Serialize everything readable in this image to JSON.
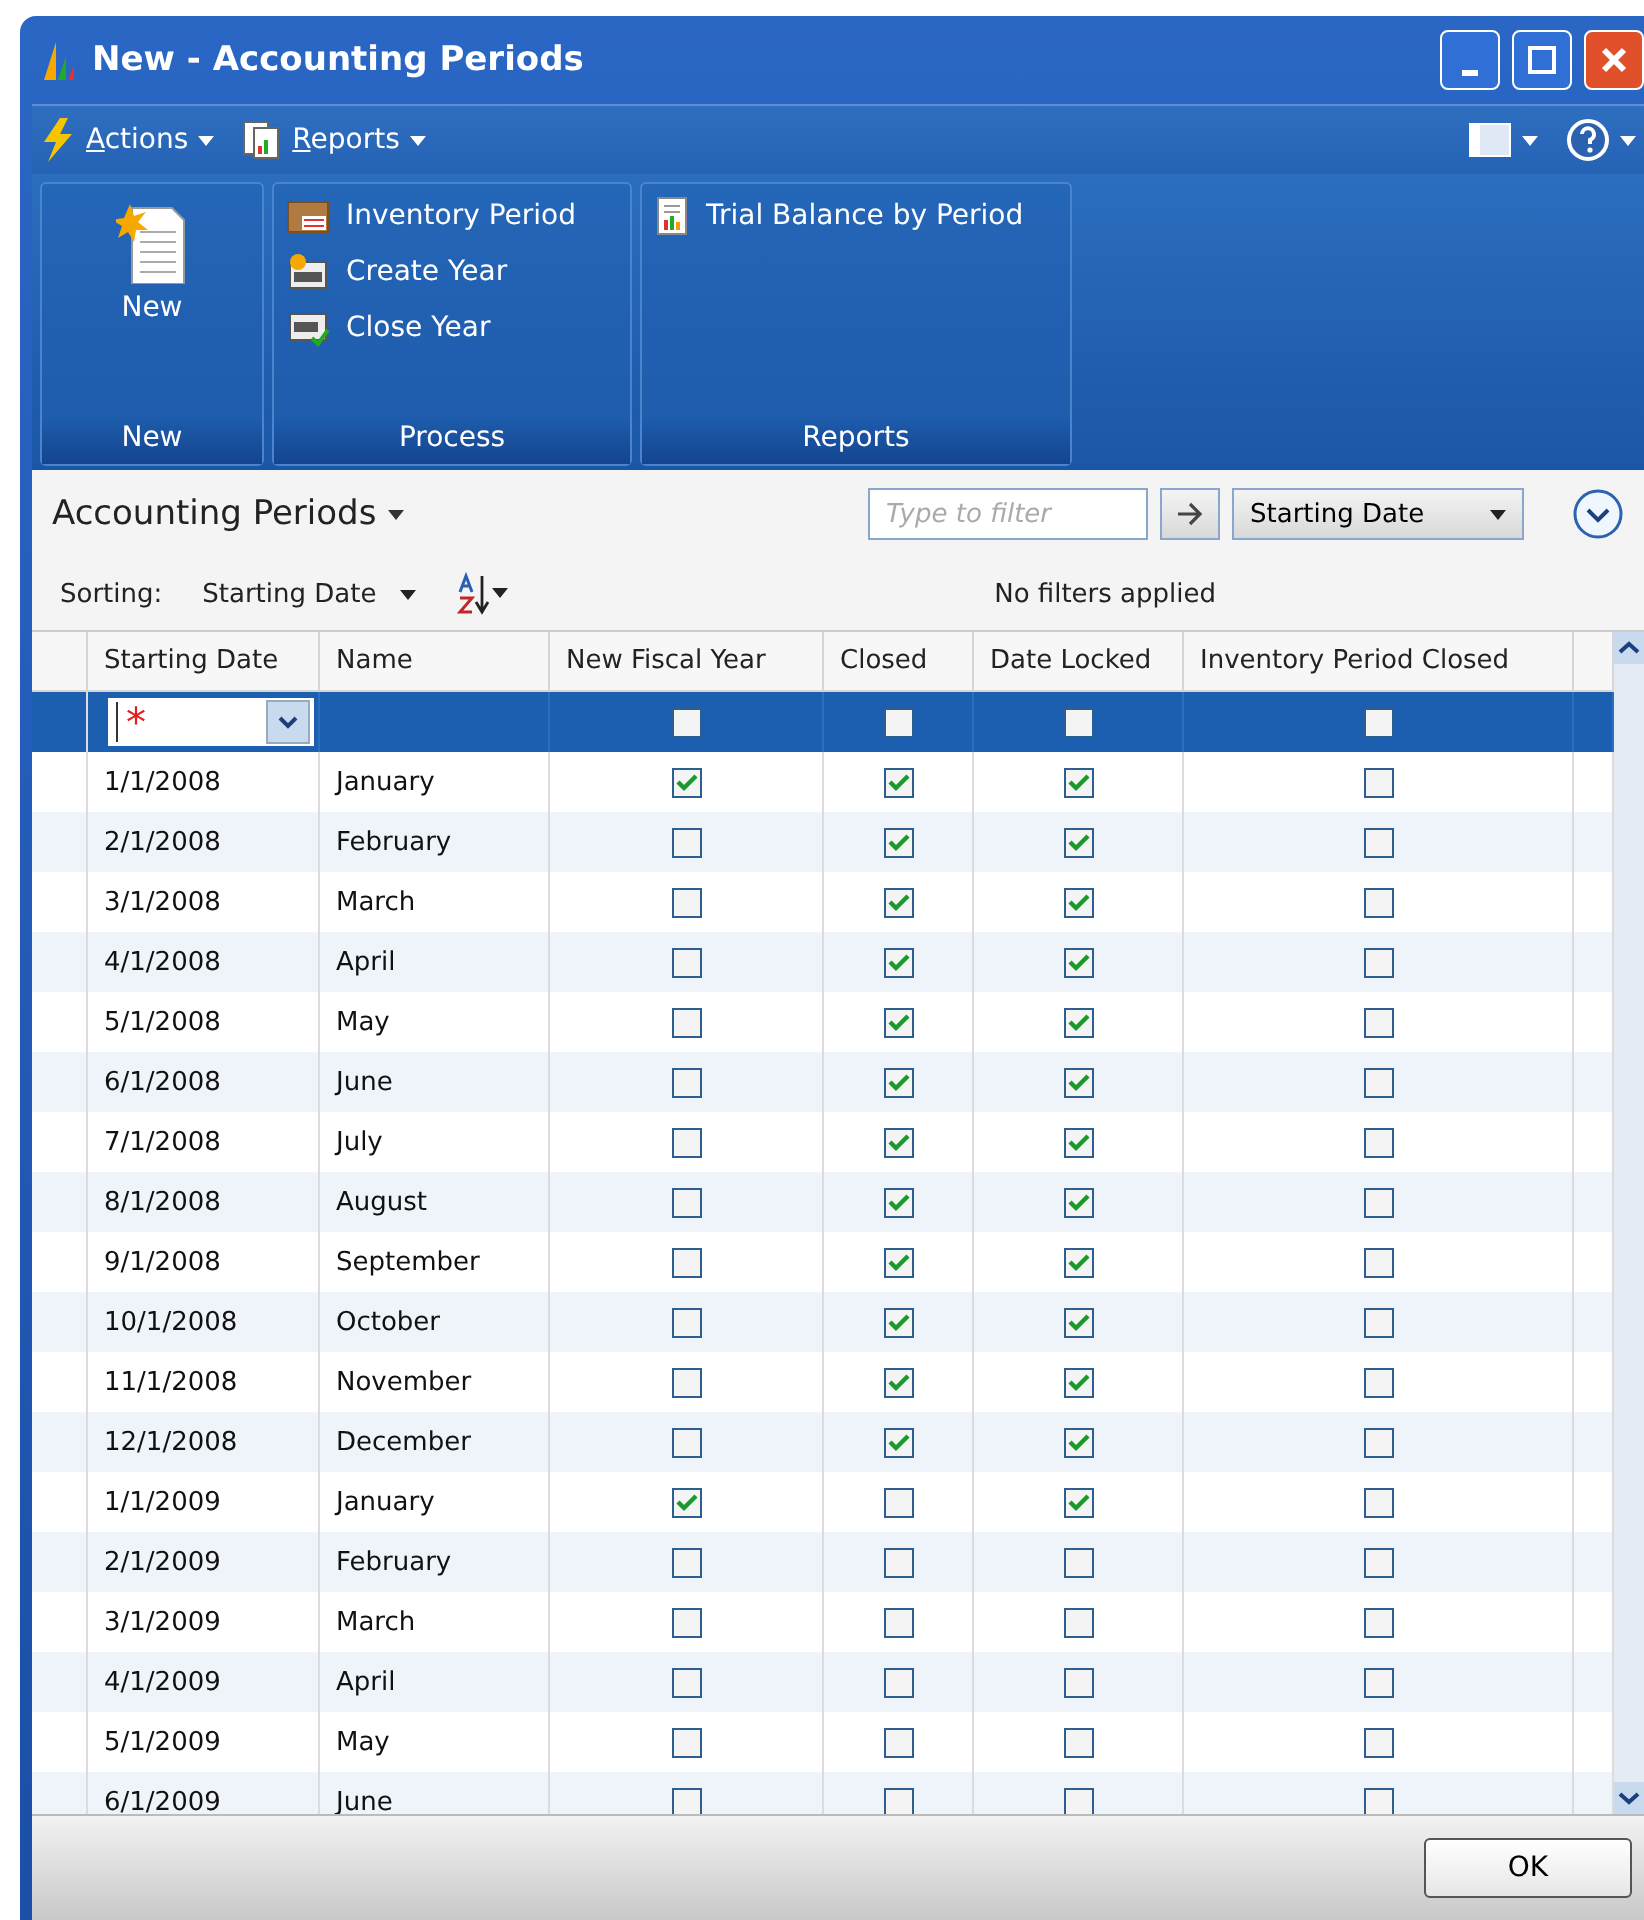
{
  "window": {
    "title": "New - Accounting Periods"
  },
  "menu": [
    {
      "label": "Actions"
    },
    {
      "label": "Reports"
    }
  ],
  "ribbon": {
    "groups": [
      {
        "kind": "large",
        "label": "New",
        "items": [
          {
            "label": "New"
          }
        ]
      },
      {
        "kind": "list",
        "label": "Process",
        "items": [
          {
            "label": "Inventory Period"
          },
          {
            "label": "Create Year"
          },
          {
            "label": "Close Year"
          }
        ]
      },
      {
        "kind": "list",
        "label": "Reports",
        "items": [
          {
            "label": "Trial Balance by Period"
          }
        ]
      }
    ]
  },
  "list": {
    "title": "Accounting Periods",
    "filter": {
      "placeholder": "Type to filter",
      "field": "Starting Date"
    },
    "sorting_label": "Sorting:",
    "sorting_field": "Starting Date",
    "filter_status": "No filters applied"
  },
  "table": {
    "columns": [
      "Starting Date",
      "Name",
      "New Fiscal Year",
      "Closed",
      "Date Locked",
      "Inventory Period Closed"
    ],
    "new_row": {
      "selected": true,
      "required_mark": "*",
      "new_fiscal_year": false,
      "closed": false,
      "date_locked": false,
      "inventory_period_closed": false
    },
    "rows": [
      {
        "starting_date": "1/1/2008",
        "name": "January",
        "new_fiscal_year": true,
        "closed": true,
        "date_locked": true,
        "inventory_period_closed": false
      },
      {
        "starting_date": "2/1/2008",
        "name": "February",
        "new_fiscal_year": false,
        "closed": true,
        "date_locked": true,
        "inventory_period_closed": false
      },
      {
        "starting_date": "3/1/2008",
        "name": "March",
        "new_fiscal_year": false,
        "closed": true,
        "date_locked": true,
        "inventory_period_closed": false
      },
      {
        "starting_date": "4/1/2008",
        "name": "April",
        "new_fiscal_year": false,
        "closed": true,
        "date_locked": true,
        "inventory_period_closed": false
      },
      {
        "starting_date": "5/1/2008",
        "name": "May",
        "new_fiscal_year": false,
        "closed": true,
        "date_locked": true,
        "inventory_period_closed": false
      },
      {
        "starting_date": "6/1/2008",
        "name": "June",
        "new_fiscal_year": false,
        "closed": true,
        "date_locked": true,
        "inventory_period_closed": false
      },
      {
        "starting_date": "7/1/2008",
        "name": "July",
        "new_fiscal_year": false,
        "closed": true,
        "date_locked": true,
        "inventory_period_closed": false
      },
      {
        "starting_date": "8/1/2008",
        "name": "August",
        "new_fiscal_year": false,
        "closed": true,
        "date_locked": true,
        "inventory_period_closed": false
      },
      {
        "starting_date": "9/1/2008",
        "name": "September",
        "new_fiscal_year": false,
        "closed": true,
        "date_locked": true,
        "inventory_period_closed": false
      },
      {
        "starting_date": "10/1/2008",
        "name": "October",
        "new_fiscal_year": false,
        "closed": true,
        "date_locked": true,
        "inventory_period_closed": false
      },
      {
        "starting_date": "11/1/2008",
        "name": "November",
        "new_fiscal_year": false,
        "closed": true,
        "date_locked": true,
        "inventory_period_closed": false
      },
      {
        "starting_date": "12/1/2008",
        "name": "December",
        "new_fiscal_year": false,
        "closed": true,
        "date_locked": true,
        "inventory_period_closed": false
      },
      {
        "starting_date": "1/1/2009",
        "name": "January",
        "new_fiscal_year": true,
        "closed": false,
        "date_locked": true,
        "inventory_period_closed": false
      },
      {
        "starting_date": "2/1/2009",
        "name": "February",
        "new_fiscal_year": false,
        "closed": false,
        "date_locked": false,
        "inventory_period_closed": false
      },
      {
        "starting_date": "3/1/2009",
        "name": "March",
        "new_fiscal_year": false,
        "closed": false,
        "date_locked": false,
        "inventory_period_closed": false
      },
      {
        "starting_date": "4/1/2009",
        "name": "April",
        "new_fiscal_year": false,
        "closed": false,
        "date_locked": false,
        "inventory_period_closed": false
      },
      {
        "starting_date": "5/1/2009",
        "name": "May",
        "new_fiscal_year": false,
        "closed": false,
        "date_locked": false,
        "inventory_period_closed": false
      },
      {
        "starting_date": "6/1/2009",
        "name": "June",
        "new_fiscal_year": false,
        "closed": false,
        "date_locked": false,
        "inventory_period_closed": false
      }
    ]
  },
  "buttons": [
    "OK"
  ]
}
